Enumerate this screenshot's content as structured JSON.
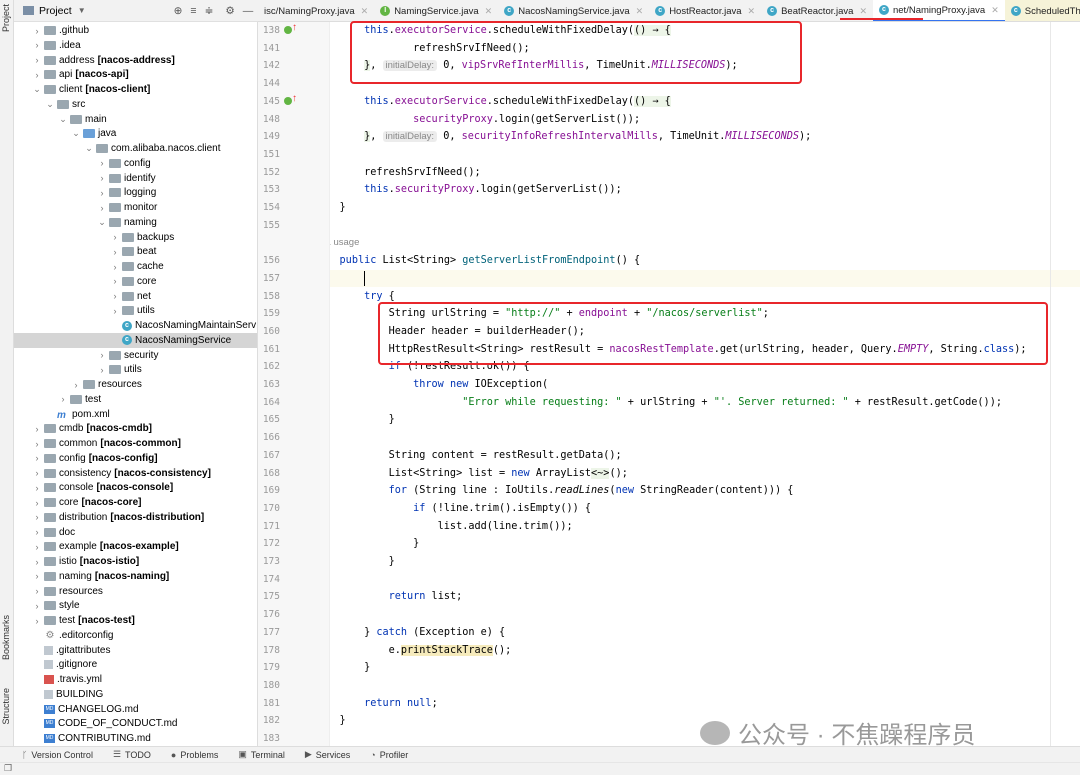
{
  "sidebar_strip": {
    "project": "Project",
    "bookmarks": "Bookmarks",
    "structure": "Structure"
  },
  "project_panel": {
    "title": "Project",
    "tree": [
      {
        "l": 0,
        "a": "c",
        "t": "folder",
        "name": ".github"
      },
      {
        "l": 0,
        "a": "c",
        "t": "folder",
        "name": ".idea"
      },
      {
        "l": 0,
        "a": "c",
        "t": "folder",
        "name": "address",
        "mod": "[nacos-address]"
      },
      {
        "l": 0,
        "a": "c",
        "t": "folder",
        "name": "api",
        "mod": "[nacos-api]"
      },
      {
        "l": 0,
        "a": "o",
        "t": "folder",
        "name": "client",
        "mod": "[nacos-client]"
      },
      {
        "l": 1,
        "a": "o",
        "t": "folder",
        "name": "src"
      },
      {
        "l": 2,
        "a": "o",
        "t": "folder",
        "name": "main"
      },
      {
        "l": 3,
        "a": "o",
        "t": "src",
        "name": "java"
      },
      {
        "l": 4,
        "a": "o",
        "t": "folder",
        "name": "com.alibaba.nacos.client"
      },
      {
        "l": 5,
        "a": "c",
        "t": "folder",
        "name": "config"
      },
      {
        "l": 5,
        "a": "c",
        "t": "folder",
        "name": "identify"
      },
      {
        "l": 5,
        "a": "c",
        "t": "folder",
        "name": "logging"
      },
      {
        "l": 5,
        "a": "c",
        "t": "folder",
        "name": "monitor"
      },
      {
        "l": 5,
        "a": "o",
        "t": "folder",
        "name": "naming"
      },
      {
        "l": 6,
        "a": "c",
        "t": "folder",
        "name": "backups"
      },
      {
        "l": 6,
        "a": "c",
        "t": "folder",
        "name": "beat"
      },
      {
        "l": 6,
        "a": "c",
        "t": "folder",
        "name": "cache"
      },
      {
        "l": 6,
        "a": "c",
        "t": "folder",
        "name": "core"
      },
      {
        "l": 6,
        "a": "c",
        "t": "folder",
        "name": "net"
      },
      {
        "l": 6,
        "a": "c",
        "t": "folder",
        "name": "utils"
      },
      {
        "l": 6,
        "a": "",
        "t": "class",
        "name": "NacosNamingMaintainServ"
      },
      {
        "l": 6,
        "a": "",
        "t": "class",
        "name": "NacosNamingService",
        "selected": true
      },
      {
        "l": 5,
        "a": "c",
        "t": "folder",
        "name": "security"
      },
      {
        "l": 5,
        "a": "c",
        "t": "folder",
        "name": "utils"
      },
      {
        "l": 3,
        "a": "c",
        "t": "folder",
        "name": "resources"
      },
      {
        "l": 2,
        "a": "c",
        "t": "folder",
        "name": "test"
      },
      {
        "l": 1,
        "a": "",
        "t": "maven",
        "name": "pom.xml"
      },
      {
        "l": 0,
        "a": "c",
        "t": "folder",
        "name": "cmdb",
        "mod": "[nacos-cmdb]"
      },
      {
        "l": 0,
        "a": "c",
        "t": "folder",
        "name": "common",
        "mod": "[nacos-common]"
      },
      {
        "l": 0,
        "a": "c",
        "t": "folder",
        "name": "config",
        "mod": "[nacos-config]"
      },
      {
        "l": 0,
        "a": "c",
        "t": "folder",
        "name": "consistency",
        "mod": "[nacos-consistency]"
      },
      {
        "l": 0,
        "a": "c",
        "t": "folder",
        "name": "console",
        "mod": "[nacos-console]"
      },
      {
        "l": 0,
        "a": "c",
        "t": "folder",
        "name": "core",
        "mod": "[nacos-core]"
      },
      {
        "l": 0,
        "a": "c",
        "t": "folder",
        "name": "distribution",
        "mod": "[nacos-distribution]"
      },
      {
        "l": 0,
        "a": "c",
        "t": "folder",
        "name": "doc"
      },
      {
        "l": 0,
        "a": "c",
        "t": "folder",
        "name": "example",
        "mod": "[nacos-example]"
      },
      {
        "l": 0,
        "a": "c",
        "t": "folder",
        "name": "istio",
        "mod": "[nacos-istio]"
      },
      {
        "l": 0,
        "a": "c",
        "t": "folder",
        "name": "naming",
        "mod": "[nacos-naming]"
      },
      {
        "l": 0,
        "a": "c",
        "t": "folder",
        "name": "resources"
      },
      {
        "l": 0,
        "a": "c",
        "t": "folder",
        "name": "style"
      },
      {
        "l": 0,
        "a": "c",
        "t": "folder",
        "name": "test",
        "mod": "[nacos-test]"
      },
      {
        "l": 0,
        "a": "",
        "t": "gear",
        "name": ".editorconfig"
      },
      {
        "l": 0,
        "a": "",
        "t": "text",
        "name": ".gitattributes"
      },
      {
        "l": 0,
        "a": "",
        "t": "text",
        "name": ".gitignore"
      },
      {
        "l": 0,
        "a": "",
        "t": "yml",
        "name": ".travis.yml"
      },
      {
        "l": 0,
        "a": "",
        "t": "text",
        "name": "BUILDING"
      },
      {
        "l": 0,
        "a": "",
        "t": "md",
        "name": "CHANGELOG.md"
      },
      {
        "l": 0,
        "a": "",
        "t": "md",
        "name": "CODE_OF_CONDUCT.md"
      },
      {
        "l": 0,
        "a": "",
        "t": "md",
        "name": "CONTRIBUTING.md"
      }
    ]
  },
  "tabs": [
    {
      "label": "isc/NamingProxy.java",
      "icon": ""
    },
    {
      "label": "NamingService.java",
      "icon": "I"
    },
    {
      "label": "NacosNamingService.java",
      "icon": "C"
    },
    {
      "label": "HostReactor.java",
      "icon": "C"
    },
    {
      "label": "BeatReactor.java",
      "icon": "C"
    },
    {
      "label": "net/NamingProxy.java",
      "icon": "C",
      "active": true
    },
    {
      "label": "ScheduledThreadPoolExecutor",
      "icon": "C",
      "pinned": true
    }
  ],
  "editor": {
    "lines": [
      {
        "n": "138",
        "impl": true,
        "t": [
          [
            "        "
          ],
          [
            "this",
            "kw"
          ],
          [
            "."
          ],
          [
            "executorService",
            "fld"
          ],
          [
            ".scheduleWithFixedDelay("
          ],
          [
            "() → {",
            "lam"
          ]
        ]
      },
      {
        "n": "141",
        "t": [
          [
            "                refreshSrvIfNeed();"
          ]
        ]
      },
      {
        "n": "142",
        "t": [
          [
            "        "
          ],
          [
            "}",
            "lam"
          ],
          [
            ", "
          ],
          [
            "initialDelay:",
            "hint"
          ],
          [
            " 0, "
          ],
          [
            "vipSrvRefInterMillis",
            "fld"
          ],
          [
            ", TimeUnit."
          ],
          [
            "MILLISECONDS",
            "it"
          ],
          [
            ");"
          ]
        ]
      },
      {
        "n": "144",
        "t": []
      },
      {
        "n": "145",
        "impl": true,
        "t": [
          [
            "        "
          ],
          [
            "this",
            "kw"
          ],
          [
            "."
          ],
          [
            "executorService",
            "fld"
          ],
          [
            ".scheduleWithFixedDelay("
          ],
          [
            "() → {",
            "lam"
          ]
        ]
      },
      {
        "n": "148",
        "t": [
          [
            "                "
          ],
          [
            "securityProxy",
            "fld"
          ],
          [
            ".login(getServerList());"
          ]
        ]
      },
      {
        "n": "149",
        "t": [
          [
            "        "
          ],
          [
            "}",
            "lam"
          ],
          [
            ", "
          ],
          [
            "initialDelay:",
            "hint"
          ],
          [
            " 0, "
          ],
          [
            "securityInfoRefreshIntervalMills",
            "fld"
          ],
          [
            ", TimeUnit."
          ],
          [
            "MILLISECONDS",
            "it"
          ],
          [
            ");"
          ]
        ]
      },
      {
        "n": "151",
        "t": []
      },
      {
        "n": "152",
        "t": [
          [
            "        refreshSrvIfNeed();"
          ]
        ]
      },
      {
        "n": "153",
        "t": [
          [
            "        "
          ],
          [
            "this",
            "kw"
          ],
          [
            "."
          ],
          [
            "securityProxy",
            "fld"
          ],
          [
            ".login(getServerList());"
          ]
        ]
      },
      {
        "n": "154",
        "t": [
          [
            "    }"
          ]
        ]
      },
      {
        "n": "155",
        "t": []
      },
      {
        "n": "",
        "usage": "1 usage",
        "t": []
      },
      {
        "n": "156",
        "t": [
          [
            "    "
          ],
          [
            "public",
            "kw"
          ],
          [
            " List<String> "
          ],
          [
            "getServerListFromEndpoint",
            "fn"
          ],
          [
            "() {"
          ]
        ]
      },
      {
        "n": "157",
        "current": true,
        "t": []
      },
      {
        "n": "158",
        "t": [
          [
            "        "
          ],
          [
            "try",
            "kw"
          ],
          [
            " {"
          ]
        ]
      },
      {
        "n": "159",
        "t": [
          [
            "            String urlString = "
          ],
          [
            "\"http://\"",
            "str"
          ],
          [
            " + "
          ],
          [
            "endpoint",
            "fld"
          ],
          [
            " + "
          ],
          [
            "\"/nacos/serverlist\"",
            "str"
          ],
          [
            ";"
          ]
        ]
      },
      {
        "n": "160",
        "t": [
          [
            "            Header header = builderHeader();"
          ]
        ]
      },
      {
        "n": "161",
        "t": [
          [
            "            HttpRestResult<String> restResult = "
          ],
          [
            "nacosRestTemplate",
            "fld"
          ],
          [
            ".get(urlString, header, Query."
          ],
          [
            "EMPTY",
            "it"
          ],
          [
            ", String."
          ],
          [
            "class",
            "kw"
          ],
          [
            ");"
          ]
        ]
      },
      {
        "n": "162",
        "t": [
          [
            "            "
          ],
          [
            "if",
            "kw"
          ],
          [
            " (!restResult.ok()) {"
          ]
        ]
      },
      {
        "n": "163",
        "t": [
          [
            "                "
          ],
          [
            "throw",
            "kw"
          ],
          [
            " "
          ],
          [
            "new",
            "kw"
          ],
          [
            " IOException("
          ]
        ]
      },
      {
        "n": "164",
        "t": [
          [
            "                        "
          ],
          [
            "\"Error while requesting: \"",
            "str"
          ],
          [
            " + urlString + "
          ],
          [
            "\"'. Server returned: \"",
            "str"
          ],
          [
            " + restResult.getCode());"
          ]
        ]
      },
      {
        "n": "165",
        "t": [
          [
            "            }"
          ]
        ]
      },
      {
        "n": "166",
        "t": []
      },
      {
        "n": "167",
        "t": [
          [
            "            String content = restResult.getData();"
          ]
        ]
      },
      {
        "n": "168",
        "t": [
          [
            "            List<String> list = "
          ],
          [
            "new",
            "kw"
          ],
          [
            " ArrayList"
          ],
          [
            "<~>",
            "lam"
          ],
          [
            "();"
          ]
        ]
      },
      {
        "n": "169",
        "t": [
          [
            "            "
          ],
          [
            "for",
            "kw"
          ],
          [
            " (String line : IoUtils."
          ],
          [
            "readLines",
            "itm"
          ],
          [
            "("
          ],
          [
            "new",
            "kw"
          ],
          [
            " StringReader(content))) {"
          ]
        ]
      },
      {
        "n": "170",
        "t": [
          [
            "                "
          ],
          [
            "if",
            "kw"
          ],
          [
            " (!line.trim().isEmpty()) {"
          ]
        ]
      },
      {
        "n": "171",
        "t": [
          [
            "                    list.add(line.trim());"
          ]
        ]
      },
      {
        "n": "172",
        "t": [
          [
            "                }"
          ]
        ]
      },
      {
        "n": "173",
        "t": [
          [
            "            }"
          ]
        ]
      },
      {
        "n": "174",
        "t": []
      },
      {
        "n": "175",
        "t": [
          [
            "            "
          ],
          [
            "return",
            "kw"
          ],
          [
            " list;"
          ]
        ]
      },
      {
        "n": "176",
        "t": []
      },
      {
        "n": "177",
        "t": [
          [
            "        } "
          ],
          [
            "catch",
            "kw"
          ],
          [
            " (Exception e) {"
          ]
        ]
      },
      {
        "n": "178",
        "t": [
          [
            "            e."
          ],
          [
            "printStackTrace",
            "warn"
          ],
          [
            "();"
          ]
        ]
      },
      {
        "n": "179",
        "t": [
          [
            "        }"
          ]
        ]
      },
      {
        "n": "180",
        "t": []
      },
      {
        "n": "181",
        "t": [
          [
            "        "
          ],
          [
            "return",
            "kw"
          ],
          [
            " "
          ],
          [
            "null",
            "kw"
          ],
          [
            ";"
          ]
        ]
      },
      {
        "n": "182",
        "t": [
          [
            "    }"
          ]
        ]
      },
      {
        "n": "183",
        "t": []
      }
    ]
  },
  "bottom_tools": [
    {
      "label": "Version Control",
      "icon": "ᚴ"
    },
    {
      "label": "TODO",
      "icon": "☰"
    },
    {
      "label": "Problems",
      "icon": "●"
    },
    {
      "label": "Terminal",
      "icon": "▣"
    },
    {
      "label": "Services",
      "icon": "▶"
    },
    {
      "label": "Profiler",
      "icon": "◔"
    }
  ],
  "watermark": "公众号 · 不焦躁程序员",
  "colors": {
    "annotation_box": "#e8262b",
    "keyword": "#0033b3",
    "field": "#871094",
    "string": "#067d17",
    "active_tab": "#3574f0"
  }
}
